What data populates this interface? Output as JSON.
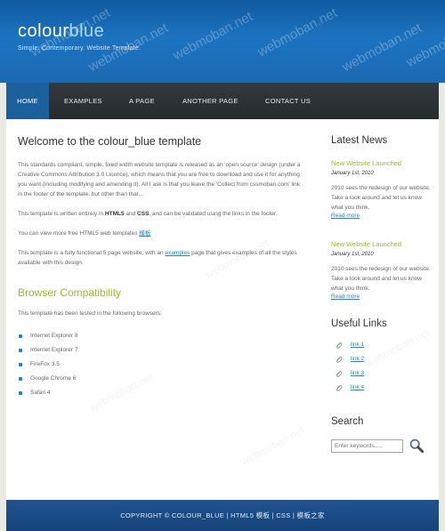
{
  "header": {
    "logo_part1": "colour",
    "logo_part2": "blue",
    "slogan": "Simple. Contemporary. Website Template.",
    "watermark": "webmoban.net"
  },
  "nav": {
    "items": [
      {
        "label": "HOME",
        "active": true
      },
      {
        "label": "EXAMPLES",
        "active": false
      },
      {
        "label": "A PAGE",
        "active": false
      },
      {
        "label": "ANOTHER PAGE",
        "active": false
      },
      {
        "label": "CONTACT US",
        "active": false
      }
    ]
  },
  "main": {
    "title": "Welcome to the colour_blue template",
    "para1": "This standards compliant, simple, fixed width website template is released as an 'open source' design (under a Creative Commons Attribution 3.0 Licence), which means that you are free to download and use it for anything you want (including modifying and amending it). All I ask is that you leave the 'Collect from cssmoban.com' link in the footer of the template, but other than that...",
    "para2_pre": "This template is written entirely in ",
    "para2_html5": "HTML5",
    "para2_and": " and ",
    "para2_css": "CSS",
    "para2_post": ", and can be validated using the links in the footer.",
    "para3_pre": "You can view more free HTML5 web templates ",
    "para3_link": "模板",
    "para4_pre": "This template is a fully functional 5 page website, with an ",
    "para4_link": "examples",
    "para4_post": " page that gives examples of all the styles available with this design.",
    "compat_title": "Browser Compatibility",
    "compat_intro": "This template has been tested in the following browsers:",
    "browsers": [
      "Internet Explorer 8",
      "Internet Explorer 7",
      "FireFox 3.5",
      "Google Chrome 6",
      "Safari 4"
    ]
  },
  "sidebar": {
    "news_title": "Latest News",
    "news": [
      {
        "title": "New Website Launched",
        "date": "January 1st, 2010",
        "body": "2010 sees the redesign of our website. Take a look around and let us know what you think.",
        "more": "Read more"
      },
      {
        "title": "New Website Launched",
        "date": "January 1st, 2010",
        "body": "2010 sees the redesign of our website. Take a look around and let us know what you think.",
        "more": "Read more"
      }
    ],
    "links_title": "Useful Links",
    "links": [
      "link 1",
      "link 2",
      "link 3",
      "link 4"
    ],
    "search_title": "Search",
    "search_placeholder": "Enter keywords....."
  },
  "footer": {
    "text": "COPYRIGHT © COLOUR_BLUE | HTML5 模板 | CSS | 模板之家"
  },
  "colors": {
    "header_blue": "#1a6ab3",
    "nav_dark": "#2c3236",
    "nav_active": "#1b5f9c",
    "accent_green": "#a1b52b",
    "link_blue": "#1f86c7",
    "footer_blue": "#1b4c85"
  }
}
